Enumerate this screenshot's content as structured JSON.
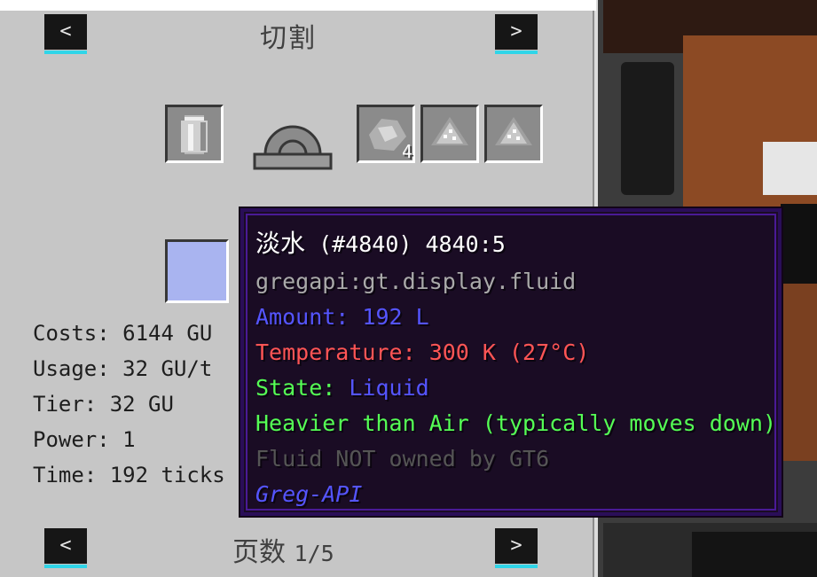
{
  "panel": {
    "title": "切割",
    "prev_label": "<",
    "next_label": ">",
    "footer": {
      "page_label": "页数",
      "page_value": "1/5"
    }
  },
  "slots": {
    "output_1_count": "4"
  },
  "stats": {
    "costs": "Costs: 6144 GU",
    "usage": "Usage: 32 GU/t",
    "tier": "Tier: 32 GU",
    "power": "Power: 1",
    "time": "Time: 192 ticks"
  },
  "tooltip": {
    "name": "淡水",
    "id": "(#4840) 4840:5",
    "registry": "gregapi:gt.display.fluid",
    "amount_label": "Amount:",
    "amount_value": "192 L",
    "temperature_label": "Temperature:",
    "temperature_value": "300 K (27°C)",
    "state_label": "State:",
    "state_value": "Liquid",
    "density": "Heavier than Air (typically moves down)",
    "ownership": "Fluid NOT owned by GT6",
    "mod": "Greg-API"
  },
  "colors": {
    "amount": "#5555ff",
    "temperature": "#ff5555",
    "state_label": "#55ff55",
    "state_value": "#5555ff",
    "density": "#55ff55",
    "ownership": "#555555",
    "mod": "#5555ff",
    "fluid_swatch": "#a9b4f0",
    "nav_underline": "#2fd5e8"
  }
}
